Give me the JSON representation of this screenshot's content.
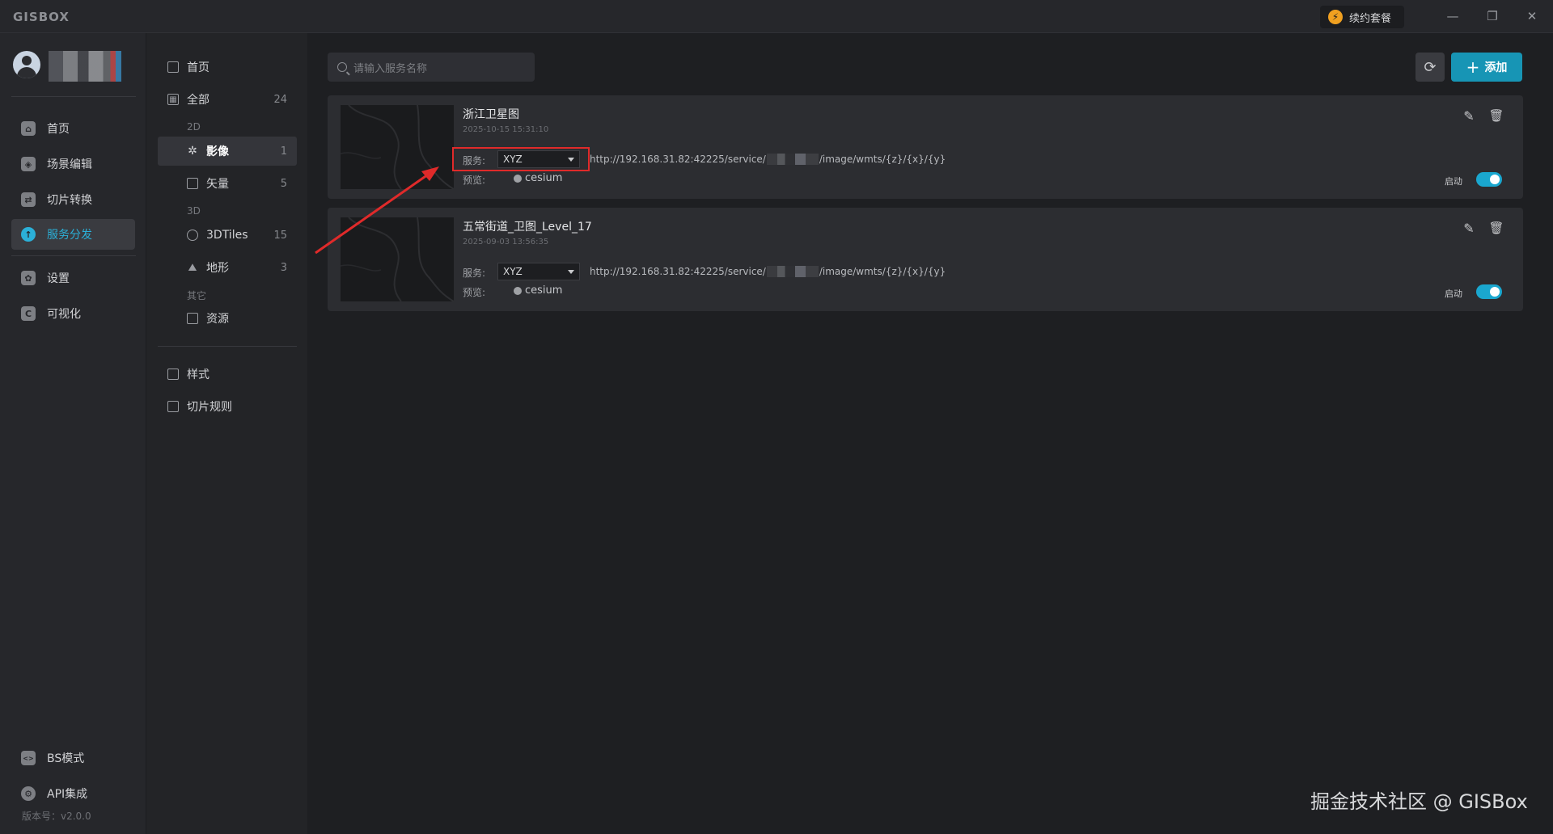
{
  "app": {
    "logo": "GISBOX",
    "renew_label": "续约套餐",
    "renew_icon": "lightning-icon"
  },
  "window": {
    "minimize": "—",
    "restore": "❐",
    "close": "✕"
  },
  "leftnav": {
    "items": [
      {
        "label": "首页",
        "icon": "home-icon",
        "glyph": "⌂"
      },
      {
        "label": "场景编辑",
        "icon": "cube-icon",
        "glyph": "◈"
      },
      {
        "label": "切片转换",
        "icon": "convert-icon",
        "glyph": "⇄"
      },
      {
        "label": "服务分发",
        "icon": "upload-icon",
        "glyph": "↑",
        "active": true
      },
      {
        "label": "设置",
        "icon": "gear-icon",
        "glyph": "✿"
      },
      {
        "label": "可视化",
        "icon": "visual-icon",
        "glyph": "C"
      }
    ],
    "bottom": [
      {
        "label": "BS模式",
        "icon": "code-icon",
        "glyph": "<>"
      },
      {
        "label": "API集成",
        "icon": "api-icon",
        "glyph": "⚙"
      }
    ],
    "version": "版本号：v2.0.0"
  },
  "categories": {
    "home": {
      "label": "首页"
    },
    "all": {
      "label": "全部",
      "count": "24"
    },
    "group_2d": "2D",
    "imagery": {
      "label": "影像",
      "count": "1"
    },
    "vector": {
      "label": "矢量",
      "count": "5"
    },
    "group_3d": "3D",
    "tiles3d": {
      "label": "3DTiles",
      "count": "15"
    },
    "terrain": {
      "label": "地形",
      "count": "3"
    },
    "group_other": "其它",
    "resource": {
      "label": "资源"
    },
    "style": {
      "label": "样式"
    },
    "tile_rule": {
      "label": "切片规则"
    }
  },
  "toolbar": {
    "search_placeholder": "请输入服务名称",
    "add_label": "添加",
    "refresh_icon": "refresh-icon"
  },
  "services": [
    {
      "title": "浙江卫星图",
      "date": "2025-10-15 15:31:10",
      "service_label": "服务:",
      "service_type": "XYZ",
      "url_prefix": "http://192.168.31.82:42225/service/",
      "url_suffix": "/image/wmts/{z}/{x}/{y}",
      "preview_label": "预览:",
      "preview_link": "cesium",
      "enable_label": "启动",
      "enabled": true
    },
    {
      "title": "五常街道_卫图_Level_17",
      "date": "2025-09-03 13:56:35",
      "service_label": "服务:",
      "service_type": "XYZ",
      "url_prefix": "http://192.168.31.82:42225/service/",
      "url_suffix": "/image/wmts/{z}/{x}/{y}",
      "preview_label": "预览:",
      "preview_link": "cesium",
      "enable_label": "启动",
      "enabled": true
    }
  ],
  "colors": {
    "accent": "#1aa7cf",
    "highlight": "#e02a2a"
  },
  "watermark": "掘金技术社区 @ GISBox"
}
